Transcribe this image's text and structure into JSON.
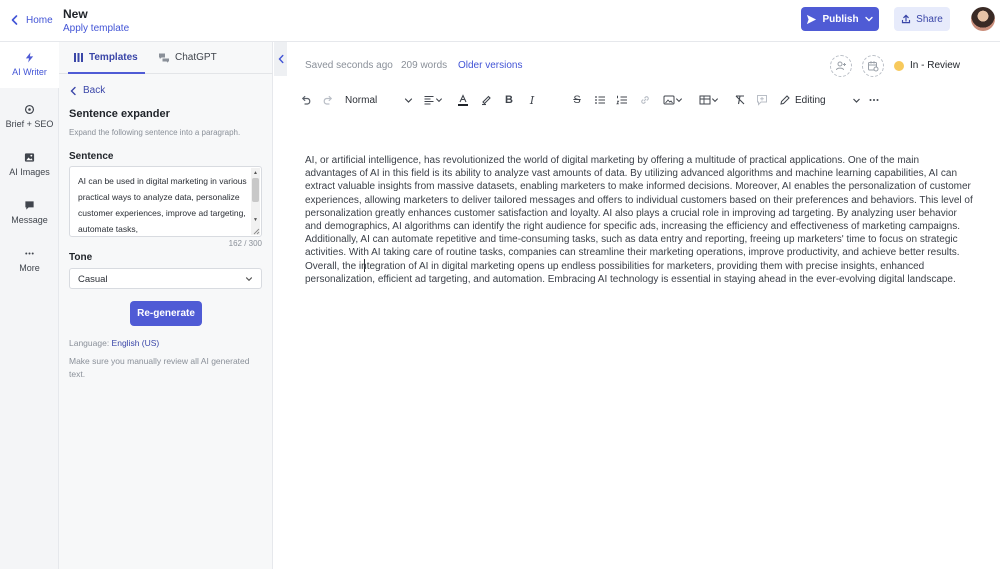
{
  "header": {
    "home_label": "Home",
    "doc_title": "New",
    "apply_template": "Apply template",
    "publish_label": "Publish",
    "share_label": "Share"
  },
  "rail": {
    "items": [
      {
        "label": "AI Writer",
        "icon": "bolt-icon"
      },
      {
        "label": "Brief + SEO",
        "icon": "target-icon"
      },
      {
        "label": "AI Images",
        "icon": "image-icon"
      },
      {
        "label": "Message",
        "icon": "chat-icon"
      },
      {
        "label": "More",
        "icon": "more-icon"
      }
    ]
  },
  "panel": {
    "tabs": [
      {
        "label": "Templates",
        "icon": "templates-icon"
      },
      {
        "label": "ChatGPT",
        "icon": "chatgpt-icon"
      }
    ],
    "back_label": "Back",
    "title": "Sentence expander",
    "subtitle": "Expand the following sentence into a paragraph.",
    "sentence_label": "Sentence",
    "sentence_value": "AI can be used in digital marketing in various practical ways to analyze data, personalize customer experiences, improve ad targeting, automate tasks,",
    "counter": "162 / 300",
    "tone_label": "Tone",
    "tone_value": "Casual",
    "regenerate_label": "Re-generate",
    "language_prefix": "Language: ",
    "language_value": "English (US)",
    "disclaimer": "Make sure you manually review all AI generated text."
  },
  "status": {
    "saved": "Saved seconds ago",
    "words": "209 words",
    "older_versions": "Older versions",
    "review_status": "In - Review",
    "review_color": "#f7c95c"
  },
  "toolbar": {
    "block_style": "Normal",
    "mode": "Editing"
  },
  "editor": {
    "body": "AI, or artificial intelligence, has revolutionized the world of digital marketing by offering a multitude of practical applications. One of the main advantages of AI in this field is its ability to analyze vast amounts of data. By utilizing advanced algorithms and machine learning capabilities, AI can extract valuable insights from massive datasets, enabling marketers to make informed decisions. Moreover, AI enables the personalization of customer experiences, allowing marketers to deliver tailored messages and offers to individual customers based on their preferences and behaviors. This level of personalization greatly enhances customer satisfaction and loyalty. AI also plays a crucial role in improving ad targeting. By analyzing user behavior and demographics, AI algorithms can identify the right audience for specific ads, increasing the efficiency and effectiveness of marketing campaigns. Additionally, AI can automate repetitive and time-consuming tasks, such as data entry and reporting, freeing up marketers' time to focus on strategic activities. With AI taking care of routine tasks, companies can streamline their marketing operations, improve productivity, and achieve better results. Overall, the integration of AI in digital marketing opens up endless possibilities for marketers, providing them with precise insights, enhanced personalization, efficient ad targeting, and automation. Embracing AI technology is essential in staying ahead in the ever-evolving digital landscape."
  },
  "colors": {
    "accent": "#4f5bd5",
    "link": "#4254d6"
  }
}
